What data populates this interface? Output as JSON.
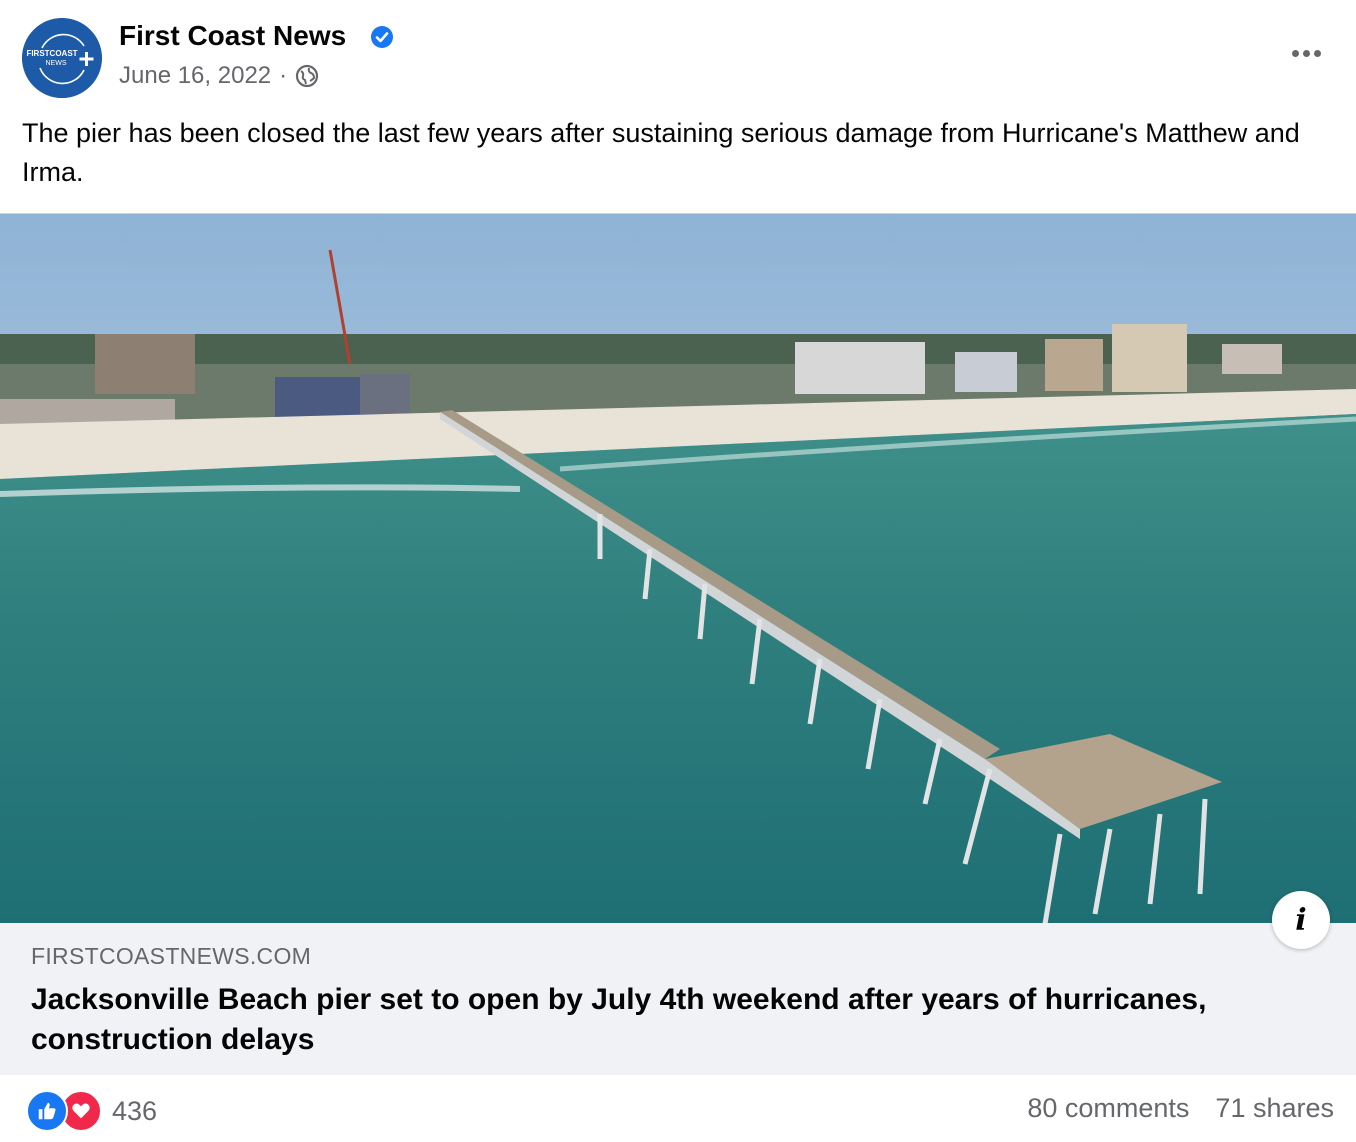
{
  "post": {
    "page_name": "First Coast News",
    "verified": true,
    "date": "June 16, 2022",
    "separator": "·",
    "audience_icon": "globe-icon",
    "avatar_text_top": "FIRSTCOAST",
    "avatar_text_bottom": "NEWS",
    "caption": "The pier has been closed the last few years after sustaining serious damage from Hurricane's Matthew and Irma."
  },
  "link_preview": {
    "domain": "FIRSTCOASTNEWS.COM",
    "headline": "Jacksonville Beach pier set to open by July 4th weekend after years of hurricanes, construction delays",
    "info_icon": "info-icon"
  },
  "footer": {
    "reaction_icons": [
      "like-icon",
      "love-icon"
    ],
    "reaction_count": "436",
    "comments": "80 comments",
    "shares": "71 shares"
  },
  "colors": {
    "brand_blue": "#1877f2",
    "love_red": "#f02849",
    "secondary_text": "#65676b",
    "link_bg": "#f0f2f5"
  }
}
